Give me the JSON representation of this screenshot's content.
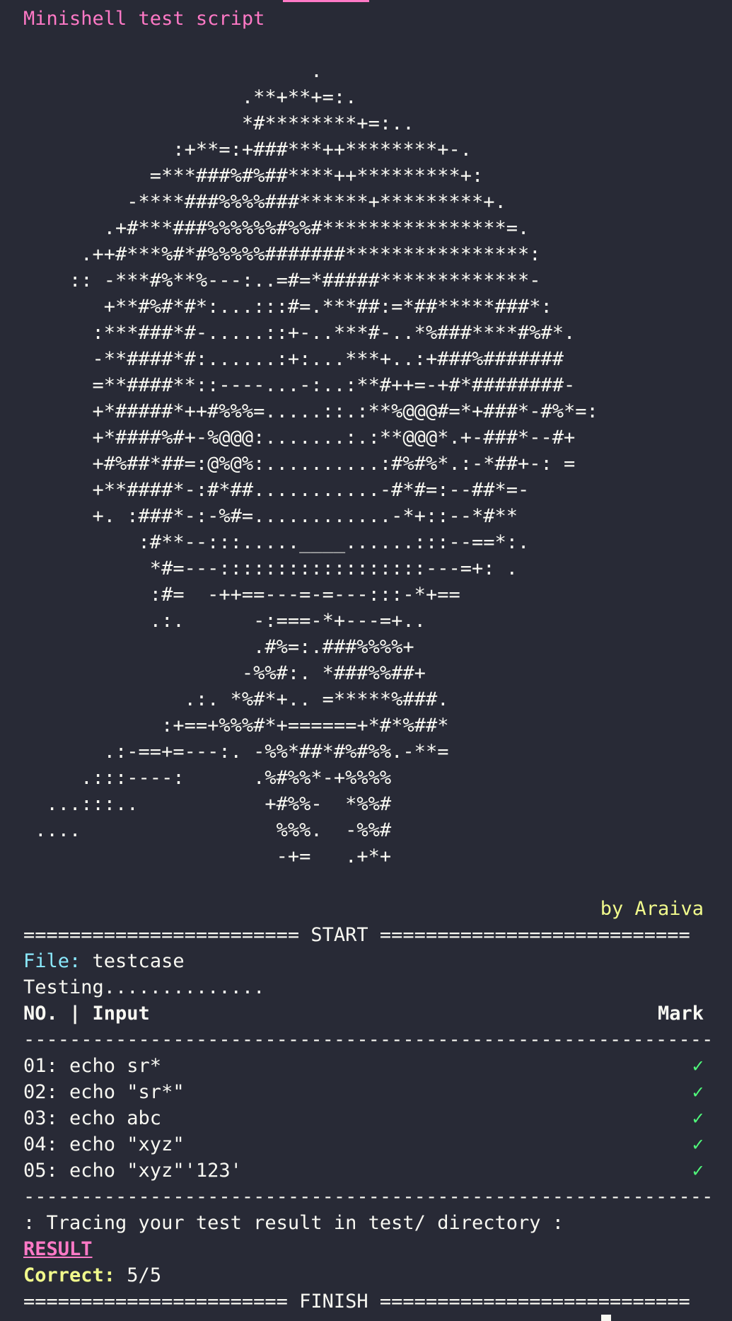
{
  "title": "Minishell test script",
  "ascii_art": [
    "                         .",
    "                   .**+**+=:.",
    "                   *#********+=:..",
    "             :+**=:+###***++********+-.",
    "           =***###%#%##****++*********+:",
    "         -****###%%%%###******+*********+.",
    "       .+#***###%%%%%%#%%#****************=.",
    "     .++#***%#*#%%%%%#######****************:",
    "    :: -***#%**%---:..=#=*#####*************-",
    "       +**#%#*#*:...:::#=.***##:=*##*****###*:",
    "      :***###*#-.....::+-..***#-..*%###****#%#*.",
    "      -**####*#:......:+:...***+..:+###%#######",
    "      =**####**::----...-:..:**#++=-+#*########-",
    "      +*#####*++#%%%=.....::.:**%@@@#=*+###*-#%*=:",
    "      +*####%#+-%@@@:.......:.:**@@@*.+-###*--#+",
    "      +#%##*##=:@%@%:..........:#%#%*.:-*##+-: =",
    "      +**####*-:#*##...........-#*#=:--##*=-",
    "      +. :###*-:-%#=............-*+::--*#**",
    "          :#**--:::.....____......:::--==*:.",
    "           *#=---::::::::::::::::::---=+: .",
    "           :#=  -++==---=-=---:::-*+==",
    "           .:.      -:===-*+---=+..",
    "                    .#%=:.###%%%%+",
    "                   -%%#:. *###%%##+",
    "              .:. *%#*+.. =*****%###.",
    "            :+==+%%%#*+======+*#*%##*",
    "       .:-==+=---:. -%%*##*#%#%%.-**=",
    "     .:::----:      .%#%%*-+%%%%",
    "  ...:::..           +#%%-  *%%#",
    " ....                 %%%.  -%%#",
    "                      -+=   .+*+"
  ],
  "author": "by Araiva",
  "start_banner": "======================== START ===========================",
  "file": {
    "label": "File:",
    "value": " testcase"
  },
  "testing_text": "Testing..............",
  "header": {
    "no_input": "NO. | Input",
    "mark": "Mark"
  },
  "divider": "------------------------------------------------------------",
  "tests": [
    {
      "line": "01: echo sr*",
      "mark": "✓"
    },
    {
      "line": "02: echo \"sr*\"",
      "mark": "✓"
    },
    {
      "line": "03: echo abc",
      "mark": "✓"
    },
    {
      "line": "04: echo \"xyz\"",
      "mark": "✓"
    },
    {
      "line": "05: echo \"xyz\"'123'",
      "mark": "✓"
    }
  ],
  "tracing_text": ": Tracing your test result in test/ directory :",
  "result_label": "RESULT",
  "correct": {
    "label": "Correct:",
    "value": " 5/5"
  },
  "finish_banner": "======================= FINISH ===========================",
  "colors": {
    "background": "#282a36",
    "foreground": "#f8f8f2",
    "pink": "#ff79c6",
    "yellow": "#f1fa8c",
    "cyan": "#8be9fd",
    "green": "#50fa7b"
  }
}
